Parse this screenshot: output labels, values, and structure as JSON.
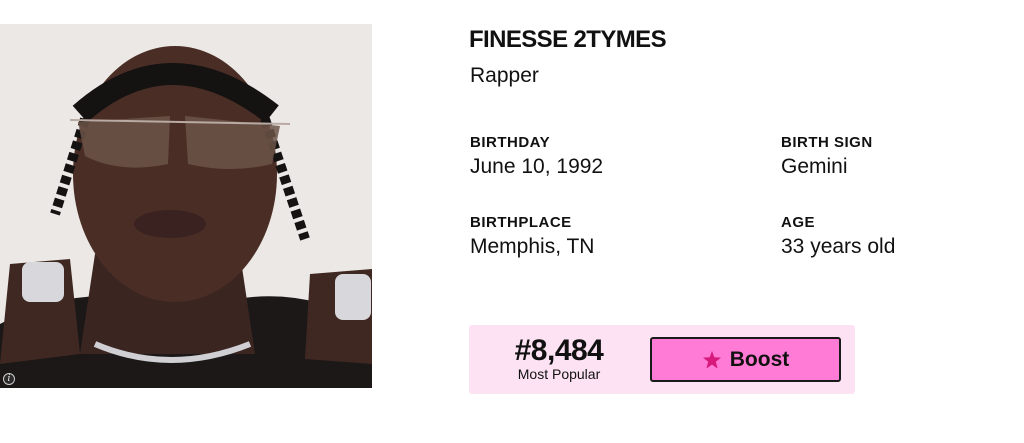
{
  "profile": {
    "name": "FINESSE 2TYMES",
    "profession": "Rapper"
  },
  "facts": {
    "birthday": {
      "label": "BIRTHDAY",
      "value": "June 10, 1992"
    },
    "birth_sign": {
      "label": "BIRTH SIGN",
      "value": "Gemini"
    },
    "birthplace": {
      "label": "BIRTHPLACE",
      "value": "Memphis, TN"
    },
    "age": {
      "label": "AGE",
      "value": "33 years old"
    }
  },
  "popularity": {
    "rank": "#8,484",
    "rank_label": "Most Popular",
    "boost_label": "Boost",
    "boost_icon": "star-icon"
  },
  "photo": {
    "info_icon": "info-icon",
    "info_glyph": "i"
  },
  "colors": {
    "card_background": "#fde2f4",
    "boost_button": "#ff7bd5",
    "boost_star": "#d6197a"
  }
}
